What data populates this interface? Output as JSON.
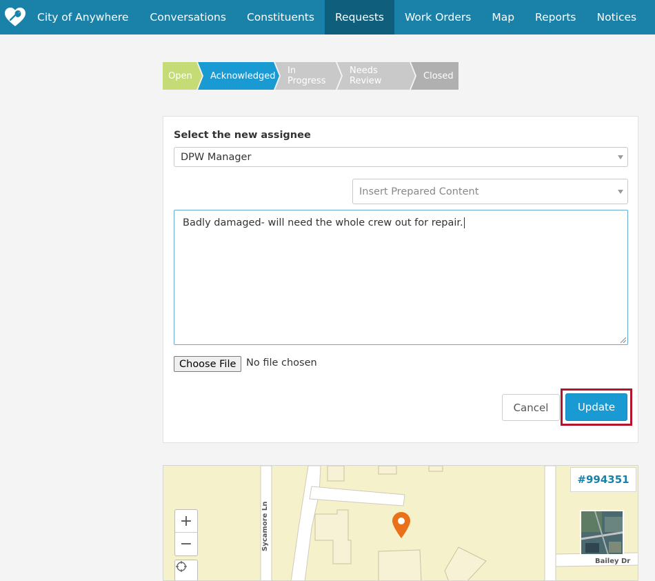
{
  "nav": {
    "brand": "City of Anywhere",
    "items": [
      {
        "label": "Conversations",
        "active": false
      },
      {
        "label": "Constituents",
        "active": false
      },
      {
        "label": "Requests",
        "active": true
      },
      {
        "label": "Work Orders",
        "active": false
      },
      {
        "label": "Map",
        "active": false
      },
      {
        "label": "Reports",
        "active": false
      },
      {
        "label": "Notices",
        "active": false
      }
    ],
    "color": "#1a82a8",
    "active_color": "#0f5f7c"
  },
  "workflow": {
    "steps": [
      {
        "label": "Open",
        "color": "#c5dc76"
      },
      {
        "label": "Acknowledged",
        "color": "#1a9ad2"
      },
      {
        "label": "In Progress",
        "color": "#c9c9c9"
      },
      {
        "label": "Needs Review",
        "color": "#c9c9c9"
      },
      {
        "label": "Closed",
        "color": "#b0b0b0"
      }
    ]
  },
  "form": {
    "assignee_label": "Select the new assignee",
    "assignee_value": "DPW Manager",
    "prepared_placeholder": "Insert Prepared Content",
    "note_text": "Badly damaged- will need the whole crew out for repair.",
    "file_button": "Choose File",
    "file_status": "No file chosen",
    "cancel_label": "Cancel",
    "update_label": "Update",
    "update_highlight_color": "#b3142c"
  },
  "map": {
    "request_id": "#994351",
    "street_1": "Sycamore Ln",
    "street_2": "Bailey Dr",
    "zoom_in": "+",
    "zoom_out": "−",
    "pin_color": "#e8711a"
  }
}
